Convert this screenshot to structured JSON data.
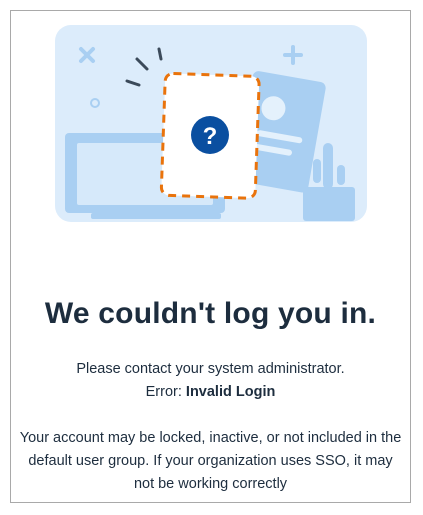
{
  "dialog": {
    "title": "We couldn't log you in.",
    "contact_message": "Please contact your system administrator.",
    "error_label": "Error:",
    "error_value": "Invalid Login",
    "details": "Your account may be locked, inactive, or not included in the default user group. If your organization uses SSO, it may not be working correctly"
  },
  "illustration": {
    "icon": "question-mark-icon",
    "accent_color": "#0a6ed1",
    "dash_color": "#e9730c",
    "background_color": "#dcecfb"
  }
}
